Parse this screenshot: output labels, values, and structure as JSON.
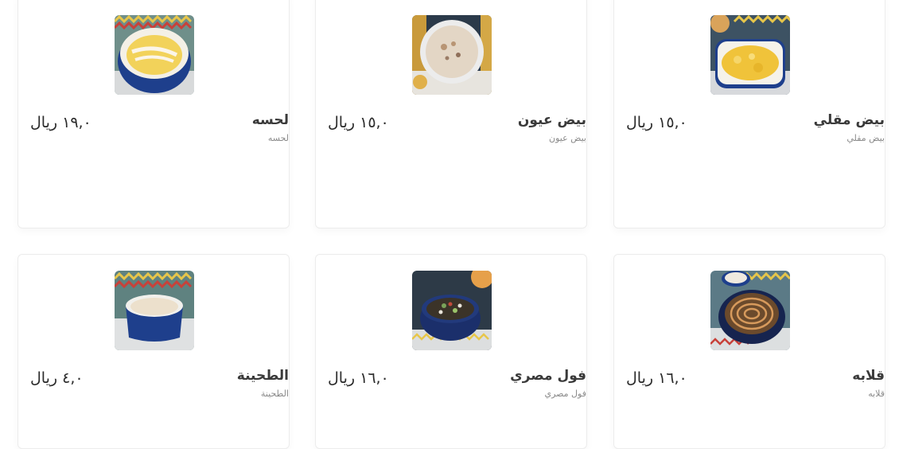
{
  "menu": {
    "items": [
      {
        "name": "لحسه",
        "description": "لحسه",
        "price": "١٩,٠ ريال",
        "image": "lahsa-dish-photo"
      },
      {
        "name": "بيض عيون",
        "description": "بيض عيون",
        "price": "١٥,٠ ريال",
        "image": "sunny-eggs-photo"
      },
      {
        "name": "بيض مقلي",
        "description": "بيض مقلي",
        "price": "١٥,٠ ريال",
        "image": "scrambled-eggs-photo"
      },
      {
        "name": "الطحينة",
        "description": "الطحينة",
        "price": "٤,٠ ريال",
        "image": "tahini-bowl-photo"
      },
      {
        "name": "فول مصري",
        "description": "فول مصري",
        "price": "١٦,٠ ريال",
        "image": "foul-pot-photo"
      },
      {
        "name": "قلابه",
        "description": "قلابه",
        "price": "١٦,٠ ريال",
        "image": "qallaba-pot-photo"
      }
    ]
  },
  "colors": {
    "card_border": "#ececec",
    "title_text": "#3a3a3a",
    "description_text": "#8a8a8a",
    "price_text": "#2b2b2b",
    "bowl_blue": "#1e3f8c"
  }
}
